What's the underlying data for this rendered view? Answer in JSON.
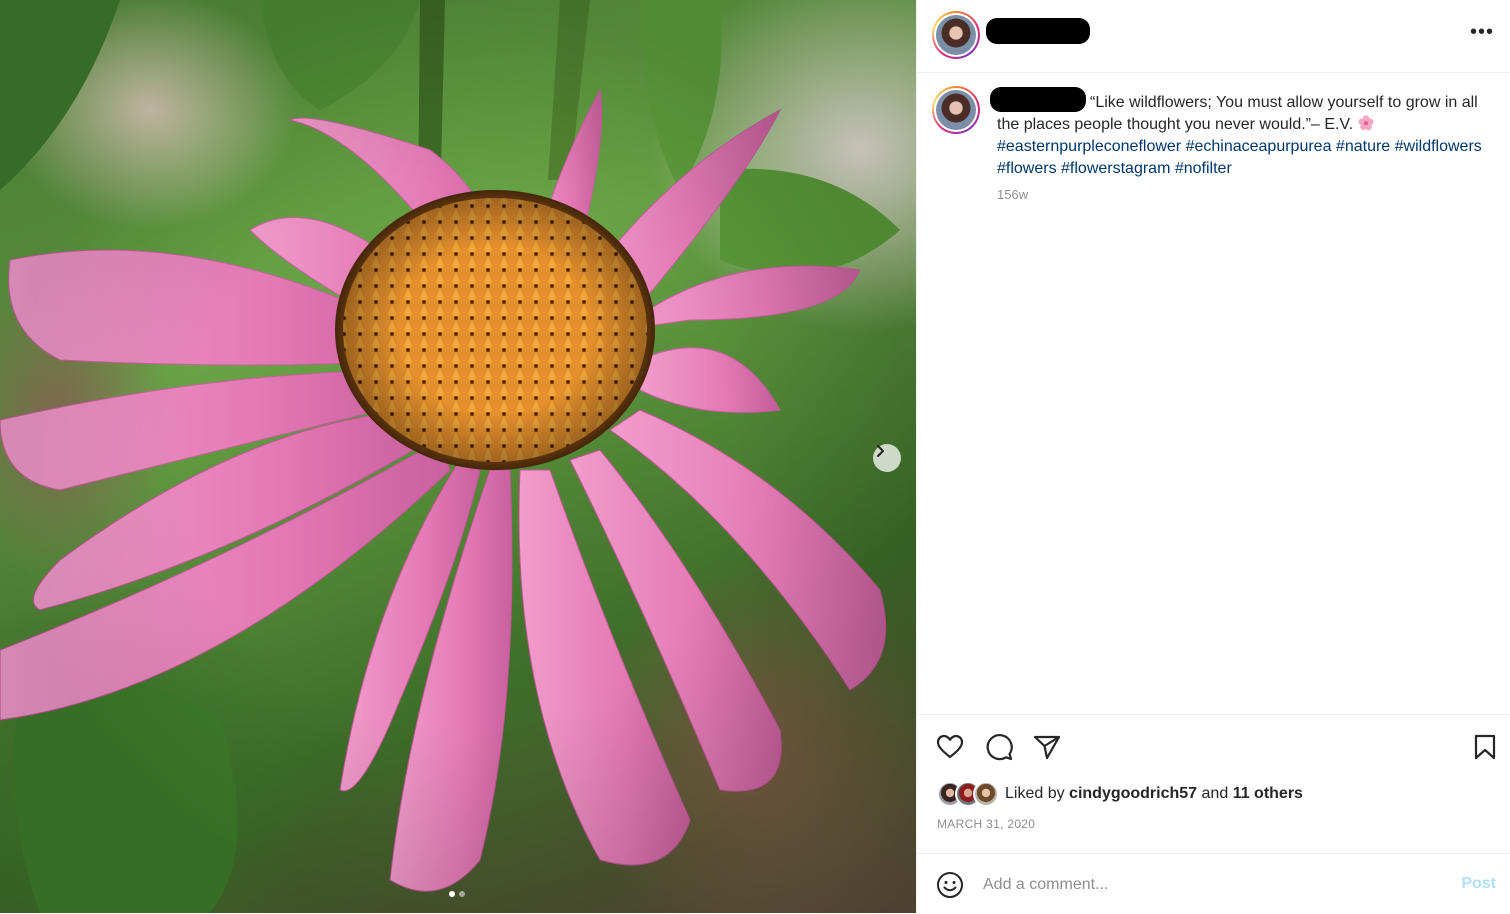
{
  "post": {
    "image_alt": "",
    "carousel": {
      "slides": 2,
      "current": 1
    }
  },
  "header": {
    "username_redacted": true,
    "more_icon": "more-horizontal-icon",
    "more_label": "•••"
  },
  "caption": {
    "text": "“Like wildflowers; You must allow yourself to grow in all the places people thought you never would.”– E.V.",
    "emoji_icon": "cherry-blossom-icon",
    "hashtags": [
      "#easternpurpleconeflower",
      "#echinaceapurpurea",
      "#nature",
      "#wildflowers",
      "#flowers",
      "#flowerstagram",
      "#nofilter"
    ],
    "time_ago": "156w"
  },
  "actions": {
    "icons": [
      "heart-icon",
      "comment-icon",
      "share-icon",
      "bookmark-icon"
    ]
  },
  "likes": {
    "prefix": "Liked by",
    "user": "cindygoodrich57",
    "joiner": "and",
    "others": "11 others"
  },
  "date": "MARCH 31, 2020",
  "comment": {
    "placeholder": "Add a comment...",
    "post_label": "Post",
    "emoji_icon": "smile-icon"
  },
  "colors": {
    "hashtag": "#00376b",
    "muted": "#8e8e8e",
    "post_disabled": "#b2dffc",
    "petal": "#e87fb8",
    "cone": "#d9791c"
  }
}
